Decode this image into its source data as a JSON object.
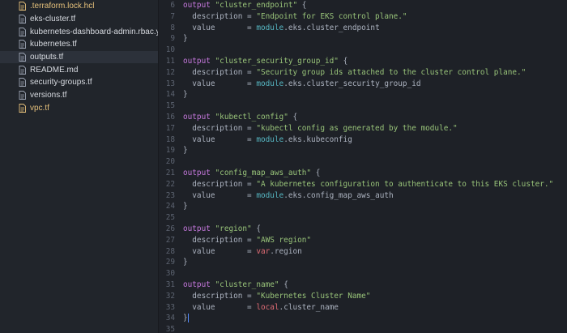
{
  "sidebar": {
    "files": [
      {
        "name": ".terraform.lock.hcl",
        "modified": true,
        "selected": false
      },
      {
        "name": "eks-cluster.tf",
        "modified": false,
        "selected": false
      },
      {
        "name": "kubernetes-dashboard-admin.rbac.yaml",
        "modified": false,
        "selected": false
      },
      {
        "name": "kubernetes.tf",
        "modified": false,
        "selected": false
      },
      {
        "name": "outputs.tf",
        "modified": false,
        "selected": true
      },
      {
        "name": "README.md",
        "modified": false,
        "selected": false
      },
      {
        "name": "security-groups.tf",
        "modified": false,
        "selected": false
      },
      {
        "name": "versions.tf",
        "modified": false,
        "selected": false
      },
      {
        "name": "vpc.tf",
        "modified": true,
        "selected": false
      }
    ]
  },
  "editor": {
    "file": "outputs.tf",
    "lines": [
      {
        "n": "6",
        "t": [
          [
            "kw",
            "output"
          ],
          [
            "plain",
            " "
          ],
          [
            "str",
            "\"cluster_endpoint\""
          ],
          [
            "plain",
            " {"
          ]
        ]
      },
      {
        "n": "7",
        "t": [
          [
            "plain",
            "  description = "
          ],
          [
            "str",
            "\"Endpoint for EKS control plane.\""
          ]
        ]
      },
      {
        "n": "8",
        "t": [
          [
            "plain",
            "  value       = "
          ],
          [
            "mod",
            "module"
          ],
          [
            "plain",
            ".eks.cluster_endpoint"
          ]
        ]
      },
      {
        "n": "9",
        "t": [
          [
            "plain",
            "}"
          ]
        ]
      },
      {
        "n": "10",
        "t": []
      },
      {
        "n": "11",
        "t": [
          [
            "kw",
            "output"
          ],
          [
            "plain",
            " "
          ],
          [
            "str",
            "\"cluster_security_group_id\""
          ],
          [
            "plain",
            " {"
          ]
        ]
      },
      {
        "n": "12",
        "t": [
          [
            "plain",
            "  description = "
          ],
          [
            "str",
            "\"Security group ids attached to the cluster control plane.\""
          ]
        ]
      },
      {
        "n": "13",
        "t": [
          [
            "plain",
            "  value       = "
          ],
          [
            "mod",
            "module"
          ],
          [
            "plain",
            ".eks.cluster_security_group_id"
          ]
        ]
      },
      {
        "n": "14",
        "t": [
          [
            "plain",
            "}"
          ]
        ]
      },
      {
        "n": "15",
        "t": []
      },
      {
        "n": "16",
        "t": [
          [
            "kw",
            "output"
          ],
          [
            "plain",
            " "
          ],
          [
            "str",
            "\"kubectl_config\""
          ],
          [
            "plain",
            " {"
          ]
        ]
      },
      {
        "n": "17",
        "t": [
          [
            "plain",
            "  description = "
          ],
          [
            "str",
            "\"kubectl config as generated by the module.\""
          ]
        ]
      },
      {
        "n": "18",
        "t": [
          [
            "plain",
            "  value       = "
          ],
          [
            "mod",
            "module"
          ],
          [
            "plain",
            ".eks.kubeconfig"
          ]
        ]
      },
      {
        "n": "19",
        "t": [
          [
            "plain",
            "}"
          ]
        ]
      },
      {
        "n": "20",
        "t": []
      },
      {
        "n": "21",
        "t": [
          [
            "kw",
            "output"
          ],
          [
            "plain",
            " "
          ],
          [
            "str",
            "\"config_map_aws_auth\""
          ],
          [
            "plain",
            " {"
          ]
        ]
      },
      {
        "n": "22",
        "t": [
          [
            "plain",
            "  description = "
          ],
          [
            "str",
            "\"A kubernetes configuration to authenticate to this EKS cluster.\""
          ]
        ]
      },
      {
        "n": "23",
        "t": [
          [
            "plain",
            "  value       = "
          ],
          [
            "mod",
            "module"
          ],
          [
            "plain",
            ".eks.config_map_aws_auth"
          ]
        ]
      },
      {
        "n": "24",
        "t": [
          [
            "plain",
            "}"
          ]
        ]
      },
      {
        "n": "25",
        "t": []
      },
      {
        "n": "26",
        "t": [
          [
            "kw",
            "output"
          ],
          [
            "plain",
            " "
          ],
          [
            "str",
            "\"region\""
          ],
          [
            "plain",
            " {"
          ]
        ]
      },
      {
        "n": "27",
        "t": [
          [
            "plain",
            "  description = "
          ],
          [
            "str",
            "\"AWS region\""
          ]
        ]
      },
      {
        "n": "28",
        "t": [
          [
            "plain",
            "  value       = "
          ],
          [
            "var",
            "var"
          ],
          [
            "plain",
            ".region"
          ]
        ]
      },
      {
        "n": "29",
        "t": [
          [
            "plain",
            "}"
          ]
        ]
      },
      {
        "n": "30",
        "t": []
      },
      {
        "n": "31",
        "t": [
          [
            "kw",
            "output"
          ],
          [
            "plain",
            " "
          ],
          [
            "str",
            "\"cluster_name\""
          ],
          [
            "plain",
            " {"
          ]
        ]
      },
      {
        "n": "32",
        "t": [
          [
            "plain",
            "  description = "
          ],
          [
            "str",
            "\"Kubernetes Cluster Name\""
          ]
        ]
      },
      {
        "n": "33",
        "t": [
          [
            "plain",
            "  value       = "
          ],
          [
            "var",
            "local"
          ],
          [
            "plain",
            ".cluster_name"
          ]
        ]
      },
      {
        "n": "34",
        "t": [
          [
            "plain",
            "}"
          ]
        ],
        "cursor": true
      },
      {
        "n": "35",
        "t": []
      }
    ]
  },
  "colors": {
    "keyword": "#c678dd",
    "string": "#98c379",
    "module": "#56b6c2",
    "variable": "#e06c75",
    "modified_file": "#e5c07b",
    "selected_row": "#2c313a"
  },
  "icons": {
    "file": "file-icon"
  }
}
